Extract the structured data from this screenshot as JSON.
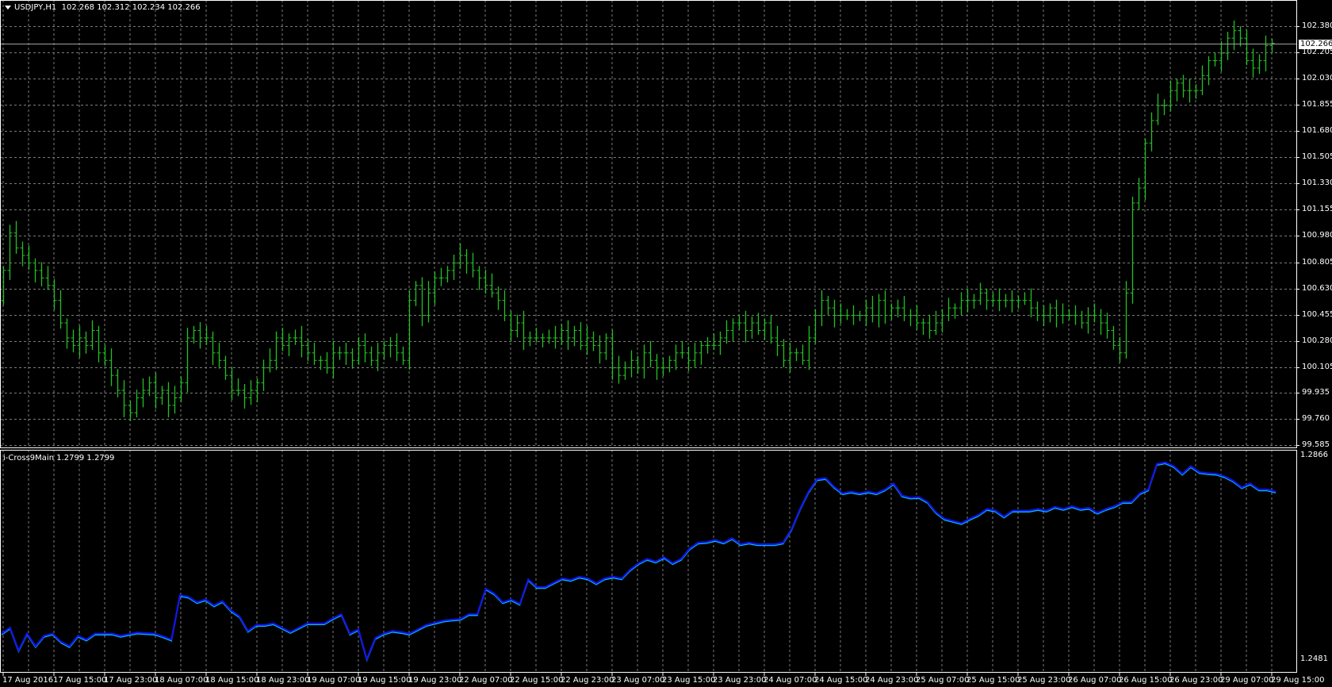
{
  "header": {
    "symbol": "USDJPY,H1",
    "open": "102.268",
    "high": "102.312",
    "low": "102.234",
    "close": "102.266"
  },
  "indicator": {
    "name": "i-Cross9Main",
    "value1": "1.2799",
    "value2": "1.2799"
  },
  "colors": {
    "background": "#000000",
    "bars": "#22c022",
    "grid": "#7a7a7a",
    "frame": "#ffffff",
    "indicator_main": "#1414e6",
    "indicator_signal": "#00c8ff",
    "current_price_line": "#a0a0a0"
  },
  "current_price": "102.266",
  "chart_data": [
    {
      "type": "ohlc-bar",
      "title": "USDJPY,H1",
      "ylim": [
        99.585,
        102.38
      ],
      "y_ticks": [
        "102.380",
        "102.205",
        "102.030",
        "101.855",
        "101.680",
        "101.505",
        "101.330",
        "101.155",
        "100.980",
        "100.805",
        "100.630",
        "100.455",
        "100.280",
        "100.105",
        "99.935",
        "99.760",
        "99.585"
      ],
      "x_ticks": [
        "17 Aug 2016",
        "17 Aug 15:00",
        "17 Aug 23:00",
        "18 Aug 07:00",
        "18 Aug 15:00",
        "18 Aug 23:00",
        "19 Aug 07:00",
        "19 Aug 15:00",
        "19 Aug 23:00",
        "22 Aug 07:00",
        "22 Aug 15:00",
        "22 Aug 23:00",
        "23 Aug 07:00",
        "23 Aug 15:00",
        "23 Aug 23:00",
        "24 Aug 07:00",
        "24 Aug 15:00",
        "24 Aug 23:00",
        "25 Aug 07:00",
        "25 Aug 15:00",
        "25 Aug 23:00",
        "26 Aug 07:00",
        "26 Aug 15:00",
        "26 Aug 23:00",
        "29 Aug 07:00",
        "29 Aug 15:00"
      ],
      "first_open": 100.55,
      "closes": [
        100.75,
        101.0,
        100.9,
        100.85,
        100.8,
        100.75,
        100.7,
        100.65,
        100.55,
        100.4,
        100.3,
        100.25,
        100.3,
        100.25,
        100.35,
        100.2,
        100.15,
        100.05,
        99.95,
        99.85,
        99.8,
        99.9,
        99.95,
        100.0,
        99.9,
        99.95,
        99.85,
        99.9,
        100.0,
        100.3,
        100.35,
        100.3,
        100.3,
        100.2,
        100.15,
        100.05,
        99.95,
        99.95,
        99.9,
        99.95,
        100.0,
        100.1,
        100.15,
        100.3,
        100.25,
        100.3,
        100.3,
        100.25,
        100.2,
        100.15,
        100.15,
        100.1,
        100.2,
        100.2,
        100.2,
        100.15,
        100.25,
        100.2,
        100.15,
        100.2,
        100.25,
        100.25,
        100.2,
        100.15,
        100.55,
        100.65,
        100.45,
        100.6,
        100.7,
        100.7,
        100.75,
        100.8,
        100.85,
        100.8,
        100.75,
        100.7,
        100.65,
        100.6,
        100.55,
        100.45,
        100.35,
        100.4,
        100.3,
        100.3,
        100.3,
        100.3,
        100.3,
        100.3,
        100.35,
        100.3,
        100.35,
        100.25,
        100.3,
        100.25,
        100.2,
        100.3,
        100.1,
        100.05,
        100.1,
        100.15,
        100.1,
        100.2,
        100.15,
        100.1,
        100.1,
        100.15,
        100.2,
        100.2,
        100.15,
        100.2,
        100.25,
        100.25,
        100.25,
        100.3,
        100.35,
        100.4,
        100.4,
        100.35,
        100.4,
        100.35,
        100.4,
        100.3,
        100.25,
        100.15,
        100.2,
        100.2,
        100.15,
        100.3,
        100.45,
        100.55,
        100.5,
        100.45,
        100.45,
        100.45,
        100.45,
        100.45,
        100.5,
        100.45,
        100.55,
        100.45,
        100.5,
        100.5,
        100.45,
        100.45,
        100.4,
        100.4,
        100.35,
        100.4,
        100.45,
        100.5,
        100.5,
        100.55,
        100.55,
        100.55,
        100.6,
        100.55,
        100.55,
        100.55,
        100.55,
        100.55,
        100.55,
        100.55,
        100.5,
        100.45,
        100.45,
        100.5,
        100.45,
        100.45,
        100.45,
        100.45,
        100.4,
        100.45,
        100.45,
        100.4,
        100.35,
        100.25,
        100.2,
        100.6,
        101.2,
        101.3,
        101.6,
        101.75,
        101.85,
        101.85,
        101.95,
        102.0,
        101.95,
        101.95,
        101.95,
        102.05,
        102.15,
        102.15,
        102.2,
        102.3,
        102.35,
        102.3,
        102.15,
        102.1,
        102.15,
        102.25,
        102.266
      ]
    },
    {
      "type": "line",
      "title": "i-Cross9Main",
      "ylim": [
        1.2481,
        1.2866
      ],
      "y_ticks": [
        "1.2866",
        "1.2481"
      ],
      "values": [
        1.2537,
        1.2548,
        1.2506,
        1.2537,
        1.2514,
        1.2533,
        1.2537,
        1.2522,
        1.2514,
        1.2533,
        1.2526,
        1.2537,
        1.2537,
        1.2537,
        1.2533,
        1.2536,
        1.2539,
        1.2538,
        1.2537,
        1.2532,
        1.2526,
        1.2608,
        1.2605,
        1.2595,
        1.26,
        1.2589,
        1.2597,
        1.258,
        1.2569,
        1.2542,
        1.2553,
        1.2553,
        1.2556,
        1.2548,
        1.254,
        1.2548,
        1.2556,
        1.2556,
        1.2556,
        1.2565,
        1.2573,
        1.2537,
        1.2545,
        1.249,
        1.2529,
        1.2537,
        1.2542,
        1.254,
        1.2537,
        1.2545,
        1.2553,
        1.2557,
        1.2561,
        1.2563,
        1.2564,
        1.2573,
        1.2573,
        1.262,
        1.2611,
        1.2595,
        1.26,
        1.2592,
        1.2637,
        1.2623,
        1.2623,
        1.2631,
        1.2639,
        1.2636,
        1.2642,
        1.2639,
        1.263,
        1.2639,
        1.2642,
        1.2639,
        1.2655,
        1.2667,
        1.2675,
        1.267,
        1.2678,
        1.2667,
        1.2675,
        1.2694,
        1.2705,
        1.2706,
        1.271,
        1.2705,
        1.2713,
        1.2702,
        1.2705,
        1.2702,
        1.2702,
        1.2702,
        1.2705,
        1.273,
        1.2767,
        1.2799,
        1.2822,
        1.2824,
        1.2808,
        1.2796,
        1.2799,
        1.2796,
        1.2799,
        1.2796,
        1.2803,
        1.2814,
        1.2792,
        1.2788,
        1.2789,
        1.278,
        1.2761,
        1.2749,
        1.2745,
        1.2741,
        1.2749,
        1.2756,
        1.2767,
        1.2764,
        1.2753,
        1.2764,
        1.2764,
        1.2764,
        1.2767,
        1.2764,
        1.2771,
        1.2767,
        1.2772,
        1.2767,
        1.2769,
        1.276,
        1.2767,
        1.2772,
        1.278,
        1.278,
        1.2796,
        1.2803,
        1.285,
        1.2853,
        1.2846,
        1.2832,
        1.2846,
        1.2835,
        1.2833,
        1.2832,
        1.2827,
        1.2819,
        1.2807,
        1.2814,
        1.2803,
        1.2803,
        1.2799
      ]
    }
  ]
}
